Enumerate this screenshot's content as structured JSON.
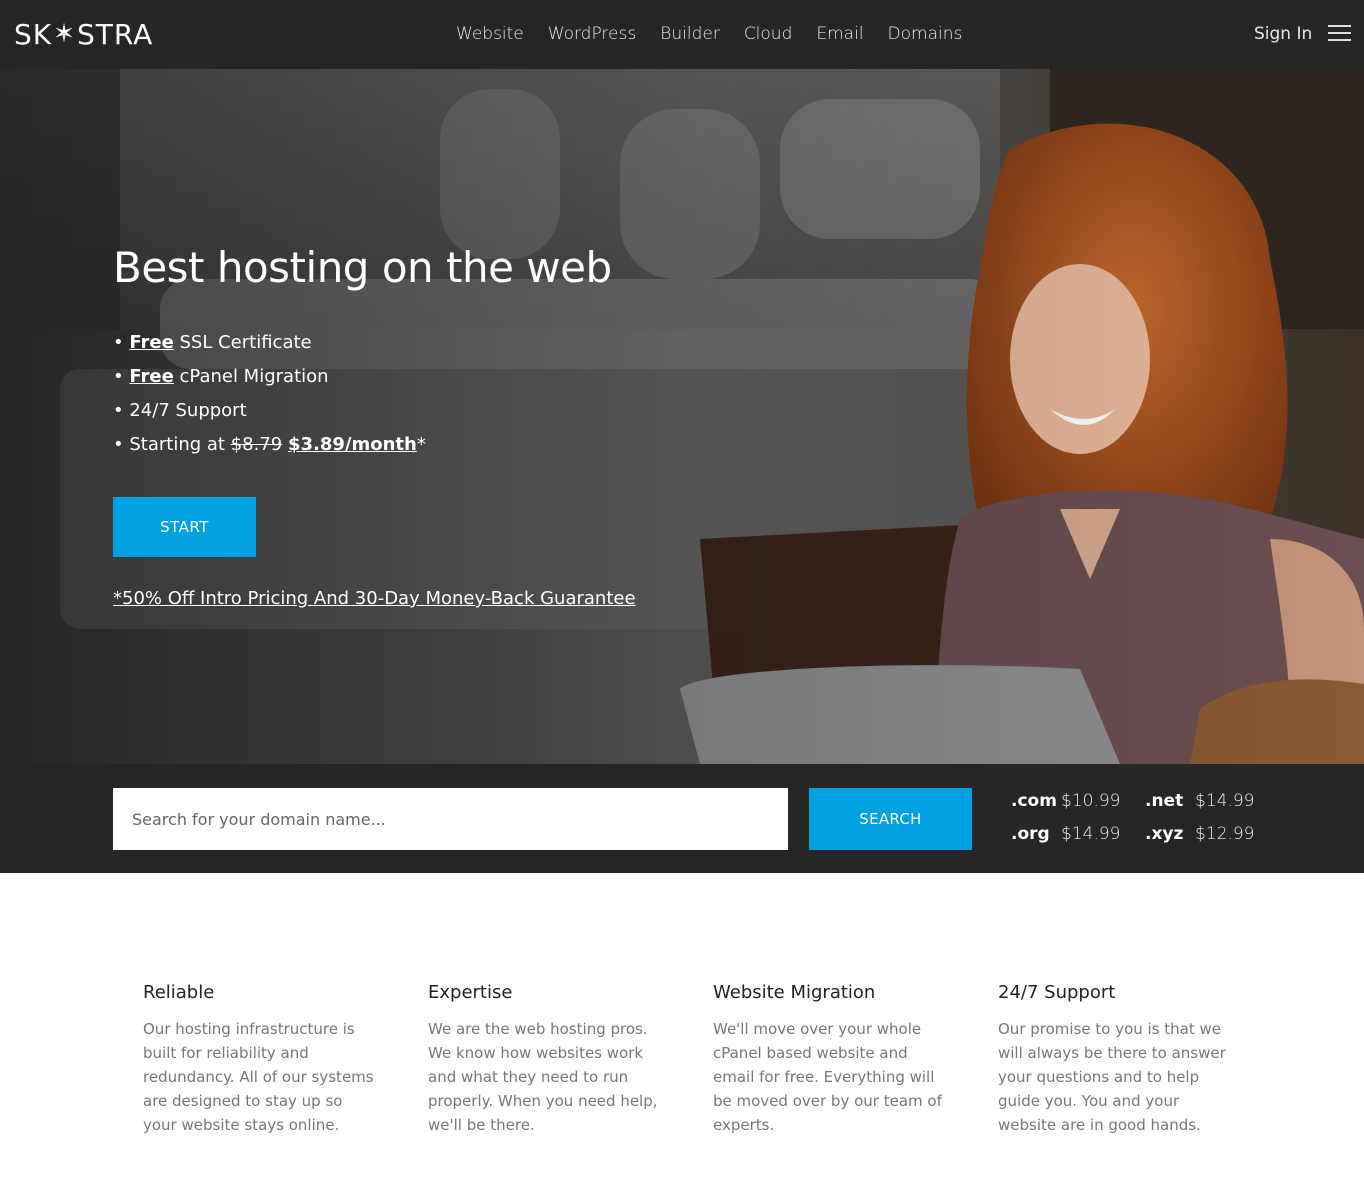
{
  "nav": {
    "logo_text_before": "SK",
    "logo_star": "✶",
    "logo_text_after": "STRA",
    "links": [
      "Website",
      "WordPress",
      "Builder",
      "Cloud",
      "Email",
      "Domains"
    ],
    "sign_in": "Sign In",
    "menu_icon": "hamburger-icon"
  },
  "hero": {
    "title": "Best hosting on the web",
    "bullets": {
      "ssl_strong": "Free",
      "ssl_rest": " SSL Certificate",
      "migration_strong": "Free",
      "migration_rest": " cPanel Migration",
      "support": "24/7 Support",
      "pricing_prefix": "Starting at ",
      "old_price": "$8.79",
      "new_price": "$3.89/month",
      "pricing_suffix": "*"
    },
    "start_button": "START",
    "promo": "*50% Off Intro Pricing And 30-Day Money-Back Guarantee"
  },
  "domain": {
    "placeholder": "Search for your domain name...",
    "search_button": "SEARCH",
    "tlds": [
      {
        "ext": ".com",
        "price": "$10.99"
      },
      {
        "ext": ".net",
        "price": "$14.99"
      },
      {
        "ext": ".org",
        "price": "$14.99"
      },
      {
        "ext": ".xyz",
        "price": "$12.99"
      }
    ]
  },
  "features": [
    {
      "title": "Reliable",
      "text": "Our hosting infrastructure is built for reliability and redundancy. All of our systems are designed to stay up so your website stays online."
    },
    {
      "title": "Expertise",
      "text": "We are the web hosting pros. We know how websites work and what they need to run properly. When you need help, we'll be there."
    },
    {
      "title": "Website Migration",
      "text": "We'll move over your whole cPanel based website and email for free. Everything will be moved over by our team of experts."
    },
    {
      "title": "24/7 Support",
      "text": "Our promise to you is that we will always be there to answer your questions and to help guide you. You and your website are in good hands."
    }
  ],
  "colors": {
    "nav_bg": "#262626",
    "accent": "#00a1e0",
    "body_text": "#777777"
  }
}
